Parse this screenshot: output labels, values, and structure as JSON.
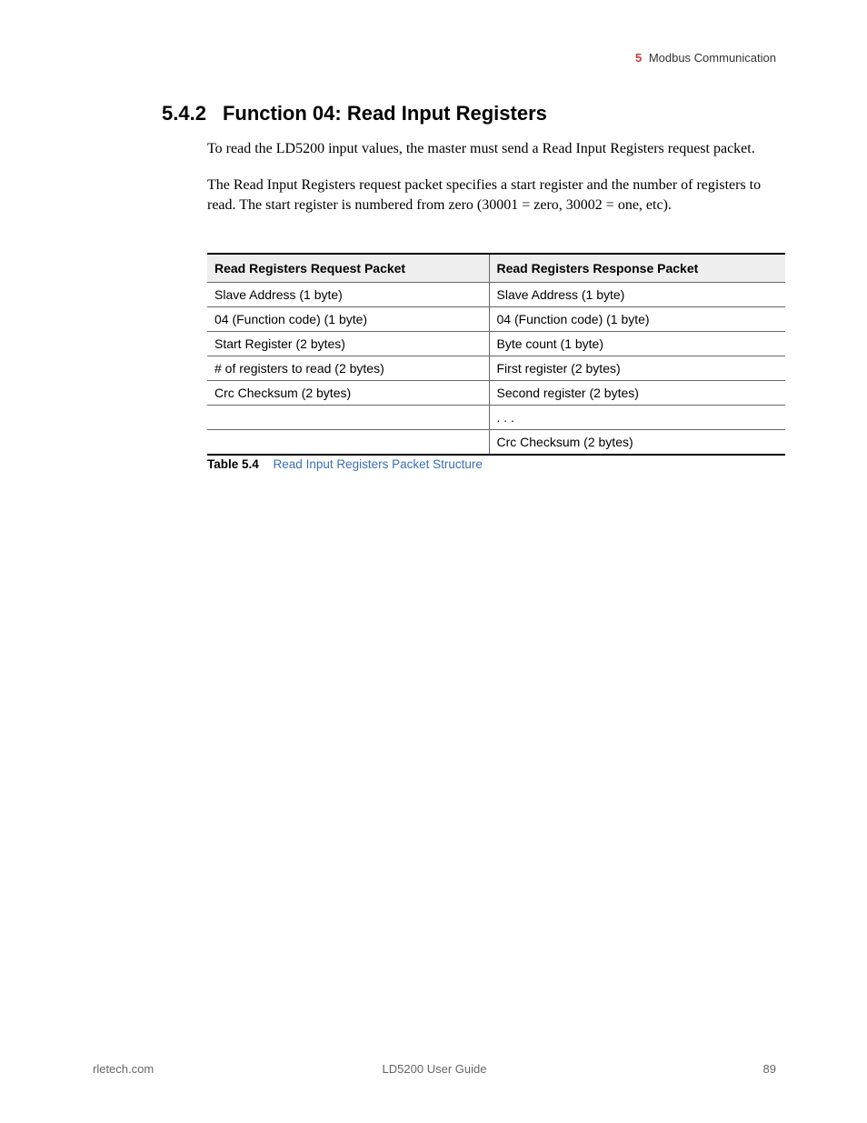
{
  "header": {
    "chapter_number": "5",
    "chapter_title": "Modbus Communication"
  },
  "section": {
    "number": "5.4.2",
    "title": "Function 04: Read Input Registers"
  },
  "paragraphs": {
    "p1": "To read the LD5200 input values, the master must send a Read Input Registers request packet.",
    "p2": "The Read Input Registers request packet specifies a start register and the number of registers to read. The start register is numbered from zero (30001 = zero, 30002 = one, etc)."
  },
  "table": {
    "headers": {
      "col1": "Read Registers Request Packet",
      "col2": "Read Registers Response Packet"
    },
    "rows": [
      {
        "c1": "Slave Address (1 byte)",
        "c2": "Slave Address (1 byte)"
      },
      {
        "c1": "04 (Function code) (1 byte)",
        "c2": "04 (Function code) (1 byte)"
      },
      {
        "c1": "Start Register (2 bytes)",
        "c2": "Byte count (1 byte)"
      },
      {
        "c1": "# of registers to read (2 bytes)",
        "c2": "First register (2 bytes)"
      },
      {
        "c1": "Crc Checksum (2 bytes)",
        "c2": "Second register (2 bytes)"
      },
      {
        "c1": "",
        "c2": ". . ."
      },
      {
        "c1": "",
        "c2": "Crc Checksum (2 bytes)"
      }
    ],
    "caption_label": "Table 5.4",
    "caption_text": "Read Input Registers Packet Structure"
  },
  "footer": {
    "left": "rletech.com",
    "center": "LD5200 User Guide",
    "right": "89"
  }
}
